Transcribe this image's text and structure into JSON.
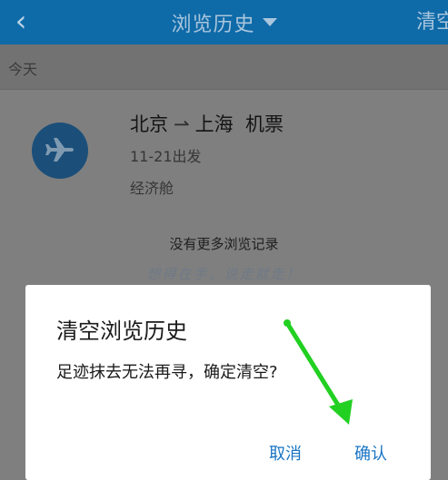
{
  "header": {
    "back_icon": "chevron-left-icon",
    "title": "浏览历史",
    "clear_label": "清空"
  },
  "section": {
    "label": "今天"
  },
  "history_item": {
    "icon": "airplane-icon",
    "origin": "北京",
    "destination": "上海",
    "product": "机票",
    "depart": "11-21出发",
    "cabin": "经济舱"
  },
  "no_more": "没有更多浏览记录",
  "slogan": "想得在手，说走就走！",
  "dialog": {
    "title": "清空浏览历史",
    "message": "足迹抹去无法再寻，确定清空?",
    "cancel_label": "取消",
    "confirm_label": "确认"
  },
  "colors": {
    "header_bg": "#0f6aa8",
    "accent": "#1874c4",
    "annotation_arrow": "#22d022"
  }
}
